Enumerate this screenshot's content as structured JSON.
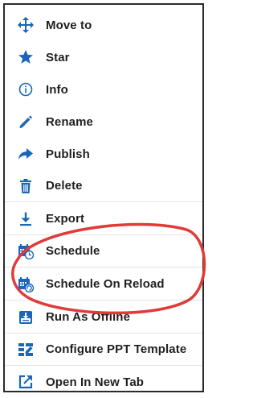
{
  "menu": {
    "items": [
      {
        "label": "Move to",
        "icon": "move-arrows-icon"
      },
      {
        "label": "Star",
        "icon": "star-icon"
      },
      {
        "label": "Info",
        "icon": "info-circle-icon"
      },
      {
        "label": "Rename",
        "icon": "pencil-icon"
      },
      {
        "label": "Publish",
        "icon": "share-arrow-icon"
      },
      {
        "label": "Delete",
        "icon": "trash-icon"
      },
      {
        "label": "Export",
        "icon": "download-icon"
      },
      {
        "label": "Schedule",
        "icon": "calendar-clock-icon"
      },
      {
        "label": "Schedule On Reload",
        "icon": "calendar-reload-icon"
      },
      {
        "label": "Run As Offline",
        "icon": "offline-download-icon"
      },
      {
        "label": "Configure PPT Template",
        "icon": "ppt-template-icon"
      },
      {
        "label": "Open In New Tab",
        "icon": "external-link-icon"
      }
    ]
  },
  "colors": {
    "icon_blue": "#1a66b8",
    "highlight_red": "#e03a3a",
    "text": "#1f1f1f"
  }
}
